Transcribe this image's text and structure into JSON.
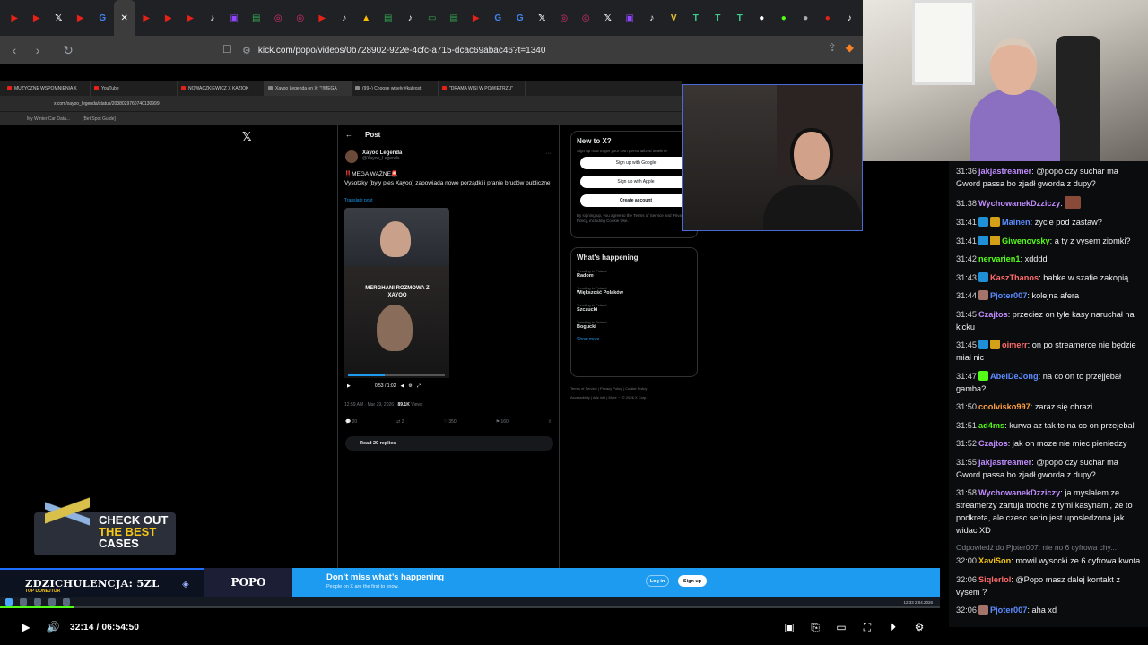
{
  "browser": {
    "url": "kick.com/popo/videos/0b728902-922e-4cfc-a715-dcac69abac46?t=1340",
    "tab_icons": [
      {
        "name": "tab-favicon",
        "color": "#e62117",
        "glyph": "▶"
      },
      {
        "name": "tab-favicon",
        "color": "#e62117",
        "glyph": "▶"
      },
      {
        "name": "x-icon",
        "color": "#ffffff",
        "glyph": "𝕏"
      },
      {
        "name": "youtube-icon",
        "color": "#e62117",
        "glyph": "▶"
      },
      {
        "name": "google-icon",
        "color": "#4285f4",
        "glyph": "G"
      },
      {
        "name": "close-icon",
        "color": "#ffffff",
        "glyph": "✕"
      },
      {
        "name": "tab-favicon",
        "color": "#e62117",
        "glyph": "▶"
      },
      {
        "name": "youtube-icon",
        "color": "#e62117",
        "glyph": "▶"
      },
      {
        "name": "youtube-icon",
        "color": "#e62117",
        "glyph": "▶"
      },
      {
        "name": "tiktok-icon",
        "color": "#ffffff",
        "glyph": "♪"
      },
      {
        "name": "twitch-icon",
        "color": "#9146ff",
        "glyph": "▣"
      },
      {
        "name": "sheets-icon",
        "color": "#34a853",
        "glyph": "▤"
      },
      {
        "name": "instagram-icon",
        "color": "#e1306c",
        "glyph": "◎"
      },
      {
        "name": "instagram-icon",
        "color": "#e1306c",
        "glyph": "◎"
      },
      {
        "name": "youtube-icon",
        "color": "#e62117",
        "glyph": "▶"
      },
      {
        "name": "tiktok-icon",
        "color": "#ffffff",
        "glyph": "♪"
      },
      {
        "name": "drive-icon",
        "color": "#fbbc04",
        "glyph": "▲"
      },
      {
        "name": "sheets-icon",
        "color": "#34a853",
        "glyph": "▤"
      },
      {
        "name": "tiktok-icon",
        "color": "#ffffff",
        "glyph": "♪"
      },
      {
        "name": "tab-favicon",
        "color": "#34a853",
        "glyph": "▭"
      },
      {
        "name": "sheets-icon",
        "color": "#34a853",
        "glyph": "▤"
      },
      {
        "name": "youtube-icon",
        "color": "#e62117",
        "glyph": "▶"
      },
      {
        "name": "google-icon",
        "color": "#4285f4",
        "glyph": "G"
      },
      {
        "name": "google-icon",
        "color": "#4285f4",
        "glyph": "G"
      },
      {
        "name": "x-icon",
        "color": "#ffffff",
        "glyph": "𝕏"
      },
      {
        "name": "instagram-icon",
        "color": "#e1306c",
        "glyph": "◎"
      },
      {
        "name": "instagram-icon",
        "color": "#e1306c",
        "glyph": "◎"
      },
      {
        "name": "x-icon",
        "color": "#ffffff",
        "glyph": "𝕏"
      },
      {
        "name": "twitch-icon",
        "color": "#9146ff",
        "glyph": "▣"
      },
      {
        "name": "tiktok-icon",
        "color": "#ffffff",
        "glyph": "♪"
      },
      {
        "name": "tab-favicon",
        "color": "#e6c229",
        "glyph": "V"
      },
      {
        "name": "tab-favicon",
        "color": "#3ecf8e",
        "glyph": "T"
      },
      {
        "name": "tab-favicon",
        "color": "#3ecf8e",
        "glyph": "T"
      },
      {
        "name": "tab-favicon",
        "color": "#3ecf8e",
        "glyph": "T"
      },
      {
        "name": "tab-favicon",
        "color": "#ffffff",
        "glyph": "●"
      },
      {
        "name": "tab-favicon",
        "color": "#53fc18",
        "glyph": "●"
      },
      {
        "name": "tab-favicon",
        "color": "#aaaaaa",
        "glyph": "●"
      },
      {
        "name": "tab-favicon",
        "color": "#e62117",
        "glyph": "●"
      },
      {
        "name": "tiktok-icon",
        "color": "#ffffff",
        "glyph": "♪"
      }
    ]
  },
  "inner_browser": {
    "tabs": [
      "MUZYCZNE WSPOMNIENIA K",
      "YouTube",
      "NOWACZKIEWICZ X KAZIOK",
      "Xayoo Legenda on X: \"!!MEGA",
      "(99+) Choose wisely #kaleost",
      "\"DRAMA WISI W POWIETRZU\""
    ],
    "url": "x.com/xayoo_legenda/status/2038029760740130999",
    "bookmarks": [
      "My Winter Car Data...",
      "[Bet Spot Guide]"
    ]
  },
  "x_post": {
    "header": "Post",
    "author_name": "Xayoo Legenda",
    "author_handle": "@Xayoo_Legenda",
    "line1": "‼️MEGA WAŻNE🚨",
    "line2": "Vysotzky (były pies Xayoo) zapowiada nowe porządki i pranie brudów publiczne",
    "translate": "Translate post",
    "video_title": "MERGHANI ROZMOWA Z XAYOO",
    "video_time": "0:53 / 1:02",
    "video_progress": 0.38,
    "meta_time": "12:59 AM · Mar 29, 2026 ·",
    "meta_views": "89.1K",
    "meta_views_label": "Views",
    "actions": {
      "replies": "20",
      "reposts": "2",
      "likes": "350",
      "bookmarks": "160"
    },
    "read_replies": "Read 20 replies"
  },
  "x_sidebar": {
    "new_title": "New to X?",
    "new_sub": "Sign up now to get your own personalized timeline!",
    "google_btn": "Sign up with Google",
    "apple_btn": "Sign up with Apple",
    "create_btn": "Create account",
    "terms": "By signing up, you agree to the Terms of Service and Privacy Policy, including Cookie Use.",
    "happening_title": "What's happening",
    "trends": [
      {
        "label": "Trending in Poland",
        "name": "Radom"
      },
      {
        "label": "Trending in Poland",
        "name": "Większość Polaków"
      },
      {
        "label": "Trending in Poland",
        "name": "Szczucki"
      },
      {
        "label": "Trending in Poland",
        "name": "Bogucki"
      }
    ],
    "show_more": "Show more",
    "footer1": "Terms of Service  |  Privacy Policy  |  Cookie Policy",
    "footer2": "Accessibility  |  Ads info  |  More ···  © 2026 X Corp."
  },
  "overlays": {
    "cases_line1": "CHECK OUT",
    "cases_line2": "THE BEST",
    "cases_line3": "CASES",
    "donator_name": "ZDZICHULENCJA: 5ZL",
    "donator_sub": "TOP DONEJTOR",
    "streamer": "POPO",
    "x_banner_title": "Don’t miss what’s happening",
    "x_banner_sub": "People on X are the first to know.",
    "x_login": "Log in",
    "x_signup": "Sign up",
    "taskbar_clock": "12:33 2.04.2026"
  },
  "chat": {
    "messages": [
      {
        "time": "31:36",
        "badges": [],
        "user": "jakjastreamer",
        "color": "#c08cff",
        "text": "@popo czy suchar ma Gword passa bo zjadł gworda z dupy?"
      },
      {
        "time": "31:38",
        "badges": [],
        "user": "WychowanekDzziczy",
        "color": "#c08cff",
        "text": "",
        "emote": true
      },
      {
        "time": "31:41",
        "badges": [
          "blue",
          "gold"
        ],
        "user": "Mainen",
        "color": "#5b8cff",
        "text": "życie pod zastaw?"
      },
      {
        "time": "31:41",
        "badges": [
          "blue",
          "gold"
        ],
        "user": "Giwenovsky",
        "color": "#53fc18",
        "text": "a ty z vysem ziomki?"
      },
      {
        "time": "31:42",
        "badges": [],
        "user": "nervarien1",
        "color": "#53fc18",
        "text": "xdddd"
      },
      {
        "time": "31:43",
        "badges": [
          "blue"
        ],
        "user": "KaszThanos",
        "color": "#ff6b6b",
        "text": "babke w szafie zakopią"
      },
      {
        "time": "31:44",
        "badges": [
          "img"
        ],
        "user": "Pjoter007",
        "color": "#5b8cff",
        "text": "kolejna afera"
      },
      {
        "time": "31:45",
        "badges": [],
        "user": "Czajtos",
        "color": "#c08cff",
        "text": "przeciez on tyle kasy naruchał na kicku"
      },
      {
        "time": "31:45",
        "badges": [
          "blue",
          "gold"
        ],
        "user": "oimerr",
        "color": "#ff6b6b",
        "text": "on po streamerce nie będzie miał nic"
      },
      {
        "time": "31:47",
        "badges": [
          "green"
        ],
        "user": "AbelDeJong",
        "color": "#5b8cff",
        "text": "na co on to przejjebał gamba?"
      },
      {
        "time": "31:50",
        "badges": [],
        "user": "coolvisko997",
        "color": "#ff9f43",
        "text": "zaraz się obrazi"
      },
      {
        "time": "31:51",
        "badges": [],
        "user": "ad4ms",
        "color": "#53fc18",
        "text": "kurwa az tak to na co on przejebal"
      },
      {
        "time": "31:52",
        "badges": [],
        "user": "Czajtos",
        "color": "#c08cff",
        "text": "jak on moze nie miec pieniedzy"
      },
      {
        "time": "31:55",
        "badges": [],
        "user": "jakjastreamer",
        "color": "#c08cff",
        "text": "@popo czy suchar ma Gword passa bo zjadł gworda z dupy?"
      },
      {
        "time": "31:58",
        "badges": [],
        "user": "WychowanekDzziczy",
        "color": "#c08cff",
        "text": "ja myslalem ze streamerzy zartuja troche z tymi kasynami, ze to podkreta, ale czesc serio jest uposledzona jak widac XD"
      },
      {
        "reply": "Odpowiedź do Pjoter007: nie no 6 cyfrowa chy..."
      },
      {
        "time": "32:00",
        "badges": [],
        "user": "XaviSon",
        "color": "#f5c518",
        "text": "mowil wysocki ze 6 cyfrowa kwota"
      },
      {
        "time": "32:06",
        "badges": [],
        "user": "Siqlerlol",
        "color": "#ff6b6b",
        "text": "@Popo masz dalej kontakt z vysem ?"
      },
      {
        "time": "32:06",
        "badges": [
          "img"
        ],
        "user": "Pjoter007",
        "color": "#5b8cff",
        "text": "aha xd"
      }
    ]
  },
  "player": {
    "time": "32:14 / 06:54:50",
    "progress": 0.078,
    "accent": "#53fc18"
  }
}
